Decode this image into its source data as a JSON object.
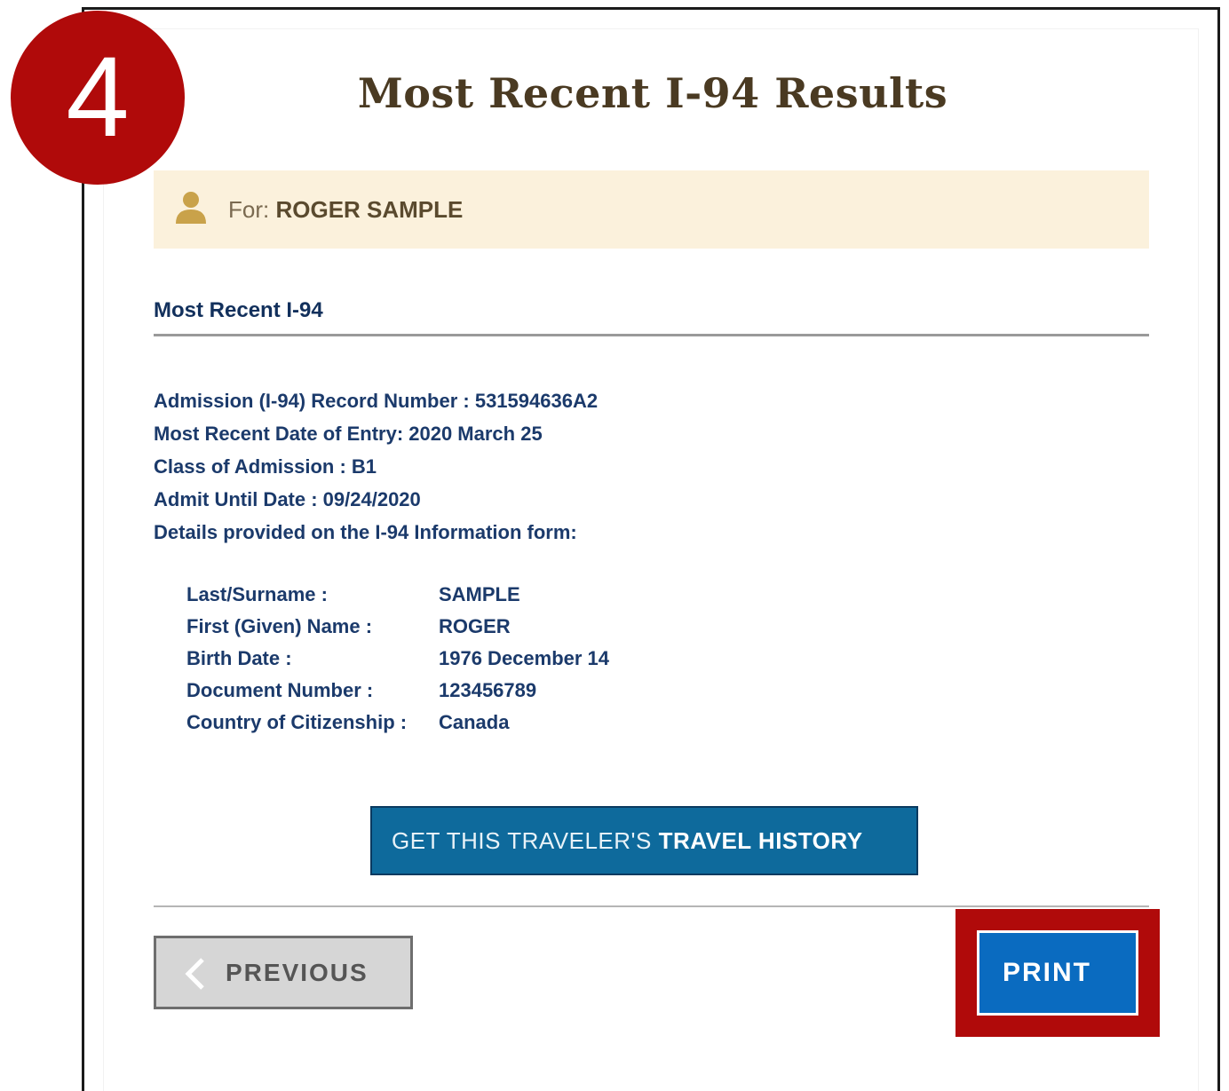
{
  "step": {
    "number": "4"
  },
  "header": {
    "title": "Most Recent I-94 Results"
  },
  "traveler": {
    "for_label": "For:",
    "name": "ROGER SAMPLE",
    "icon": "person-icon"
  },
  "section": {
    "title": "Most Recent I-94"
  },
  "record": {
    "admission_number": "Admission (I-94) Record Number : 531594636A2",
    "entry_date": "Most Recent Date of Entry: 2020 March 25",
    "class_of_admission": "Class of Admission : B1",
    "admit_until": "Admit Until Date : 09/24/2020",
    "details_intro": "Details provided on the I-94 Information form:"
  },
  "details": {
    "rows": [
      {
        "label": "Last/Surname :",
        "value": "SAMPLE"
      },
      {
        "label": "First (Given) Name :",
        "value": "ROGER"
      },
      {
        "label": "Birth Date :",
        "value": "1976 December 14"
      },
      {
        "label": "Document Number :",
        "value": "123456789"
      },
      {
        "label": "Country of Citizenship :",
        "value": "Canada"
      }
    ]
  },
  "actions": {
    "history_prefix": "GET THIS TRAVELER'S",
    "history_strong": "TRAVEL HISTORY",
    "previous_label": "PREVIOUS",
    "print_label": "PRINT"
  },
  "colors": {
    "badge": "#b00a0a",
    "highlight": "#b00a0a",
    "history_button": "#0e6a9c",
    "print_button": "#0a6bc0",
    "text_blue": "#1b3a6b",
    "title_brown": "#4a3a22",
    "for_bar": "#fbf1dc"
  }
}
